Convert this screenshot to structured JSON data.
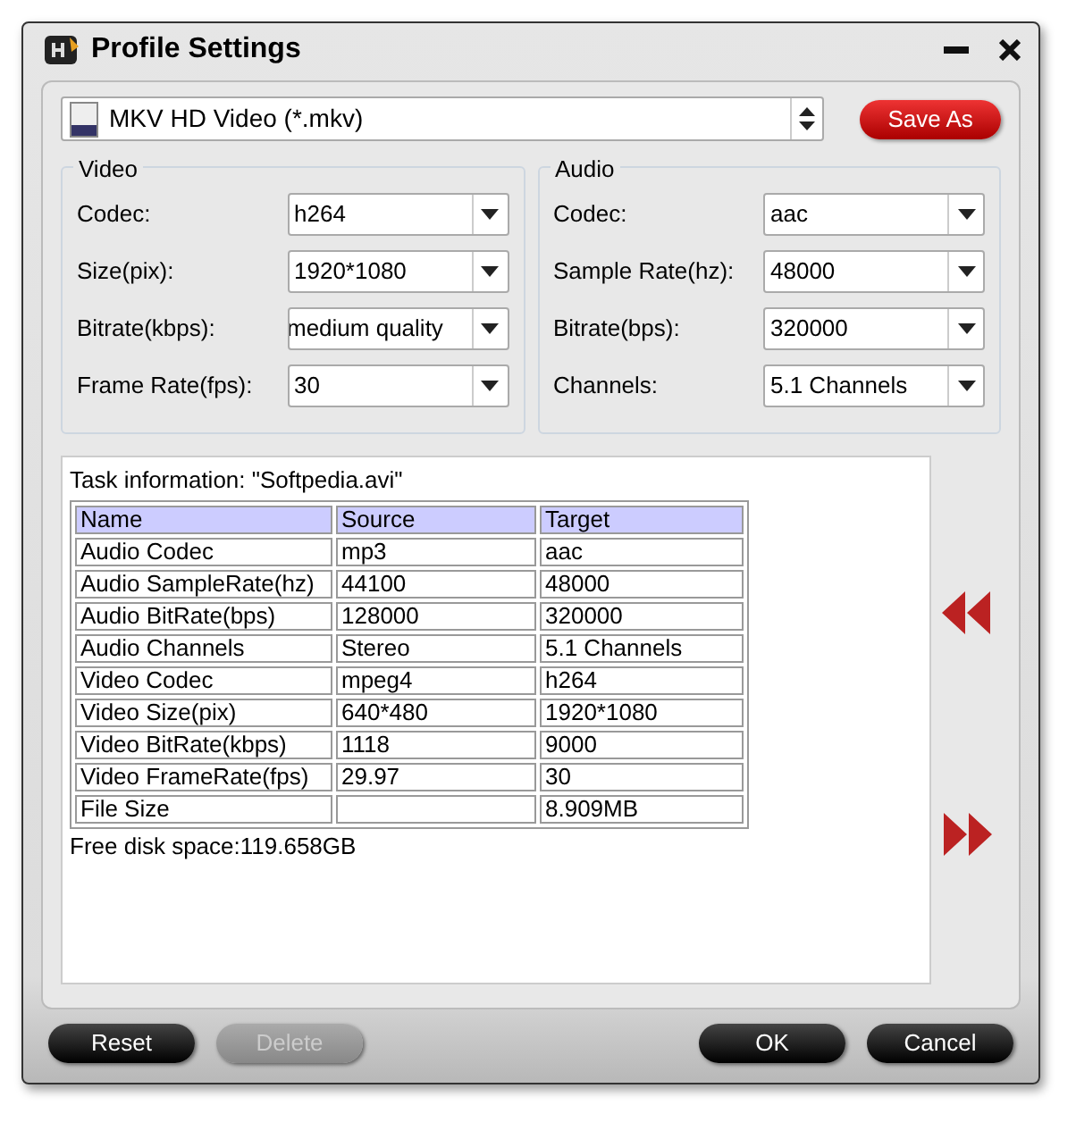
{
  "window": {
    "title": "Profile Settings"
  },
  "format": {
    "value": "MKV HD Video (*.mkv)"
  },
  "save_as": "Save As",
  "groups": [
    {
      "title": "Video",
      "fields": [
        {
          "label": "Codec:",
          "value": "h264"
        },
        {
          "label": "Size(pix):",
          "value": "1920*1080"
        },
        {
          "label": "Bitrate(kbps):",
          "value": "medium quality"
        },
        {
          "label": "Frame Rate(fps):",
          "value": "30"
        }
      ]
    },
    {
      "title": "Audio",
      "fields": [
        {
          "label": "Codec:",
          "value": "aac"
        },
        {
          "label": "Sample Rate(hz):",
          "value": "48000"
        },
        {
          "label": "Bitrate(bps):",
          "value": "320000"
        },
        {
          "label": "Channels:",
          "value": "5.1 Channels"
        }
      ]
    }
  ],
  "task": {
    "title": "Task information: \"Softpedia.avi\"",
    "columns": [
      "Name",
      "Source",
      "Target"
    ],
    "rows": [
      [
        "Audio Codec",
        "mp3",
        "aac"
      ],
      [
        "Audio SampleRate(hz)",
        "44100",
        "48000"
      ],
      [
        "Audio BitRate(bps)",
        "128000",
        "320000"
      ],
      [
        "Audio Channels",
        "Stereo",
        "5.1 Channels"
      ],
      [
        "Video Codec",
        "mpeg4",
        "h264"
      ],
      [
        "Video Size(pix)",
        "640*480",
        "1920*1080"
      ],
      [
        "Video BitRate(kbps)",
        "1118",
        "9000"
      ],
      [
        "Video FrameRate(fps)",
        "29.97",
        "30"
      ],
      [
        "File Size",
        "",
        "8.909MB"
      ]
    ],
    "free_space": "Free disk space:119.658GB"
  },
  "left_buttons": [
    {
      "label": "Reset",
      "disabled": false
    },
    {
      "label": "Delete",
      "disabled": true
    }
  ],
  "right_buttons": [
    {
      "label": "OK",
      "disabled": false
    },
    {
      "label": "Cancel",
      "disabled": false
    }
  ]
}
